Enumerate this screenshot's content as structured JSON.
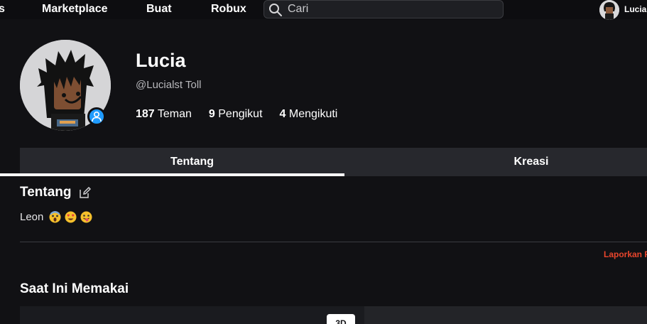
{
  "nav": {
    "items": [
      {
        "label": "s"
      },
      {
        "label": "Marketplace"
      },
      {
        "label": "Buat"
      },
      {
        "label": "Robux"
      }
    ],
    "search": {
      "placeholder": "Cari",
      "icon": "search-icon"
    },
    "user": {
      "name": "Lucia"
    }
  },
  "profile": {
    "display_name": "Lucia",
    "username": "@Lucialst Toll",
    "stats": [
      {
        "count": "187",
        "label": "Teman"
      },
      {
        "count": "9",
        "label": "Pengikut"
      },
      {
        "count": "4",
        "label": "Mengikuti"
      }
    ],
    "online_color": "#1f9bff"
  },
  "tabs": [
    {
      "label": "Tentang",
      "active": true
    },
    {
      "label": "Kreasi",
      "active": false
    }
  ],
  "about": {
    "title": "Tentang",
    "text": "Leon",
    "emojis": [
      "screaming-emoji",
      "heart-eyes-emoji",
      "tongue-emoji"
    ]
  },
  "report": {
    "label": "Laporkan P",
    "color": "#e8452c"
  },
  "wearing": {
    "title": "Saat Ini Memakai",
    "toggle_label": "3D"
  }
}
